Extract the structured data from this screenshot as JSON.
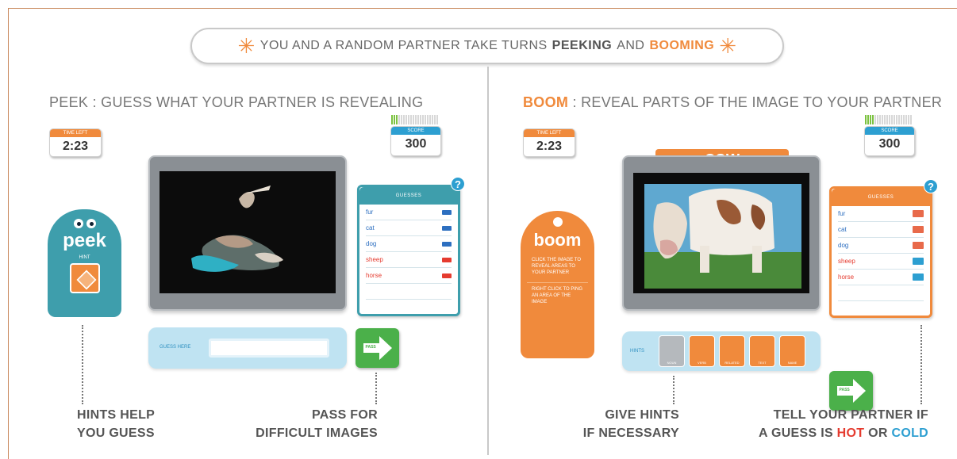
{
  "banner": {
    "text_pre": "YOU AND A RANDOM PARTNER TAKE TURNS",
    "peeking": "PEEKING",
    "and": "AND",
    "booming": "BOOMING"
  },
  "peek": {
    "title_hl": "PEEK",
    "title_rest": ": GUESS WHAT YOUR PARTNER IS REVEALING",
    "timer_caption": "TIME LEFT",
    "timer": "2:23",
    "score_caption": "SCORE",
    "score": "300",
    "character_label": "peek",
    "character_small": "HINT",
    "guesses_header": "GUESSES",
    "guesses": [
      {
        "word": "fur",
        "color": "#2d6fc0",
        "tag": "#2d6fc0"
      },
      {
        "word": "cat",
        "color": "#2d6fc0",
        "tag": "#2d6fc0"
      },
      {
        "word": "dog",
        "color": "#2d6fc0",
        "tag": "#2d6fc0"
      },
      {
        "word": "sheep",
        "color": "#e53b2f",
        "tag": "#e53b2f"
      },
      {
        "word": "horse",
        "color": "#e53b2f",
        "tag": "#e53b2f"
      }
    ],
    "guess_label": "GUESS HERE",
    "guess_value": "",
    "pass_label": "PASS",
    "caption_left": [
      "HINTS HELP",
      "YOU GUESS"
    ],
    "caption_right": [
      "PASS FOR",
      "DIFFICULT IMAGES"
    ]
  },
  "boom": {
    "title_hl": "BOOM",
    "title_rest": ": REVEAL PARTS OF THE IMAGE TO YOUR PARTNER",
    "timer_caption": "TIME LEFT",
    "timer": "2:23",
    "score_caption": "SCORE",
    "score": "300",
    "word": "COW",
    "character_label": "boom",
    "character_instr": "CLICK THE IMAGE TO REVEAL AREAS TO YOUR PARTNER",
    "character_instr2": "RIGHT CLICK TO PING AN AREA OF THE IMAGE",
    "guesses_header": "GUESSES",
    "guesses": [
      {
        "word": "fur",
        "color": "#2d6fc0",
        "tag": "#e86a4a"
      },
      {
        "word": "cat",
        "color": "#2d6fc0",
        "tag": "#e86a4a"
      },
      {
        "word": "dog",
        "color": "#2d6fc0",
        "tag": "#e86a4a"
      },
      {
        "word": "sheep",
        "color": "#e53b2f",
        "tag": "#2d9fd1"
      },
      {
        "word": "horse",
        "color": "#e53b2f",
        "tag": "#2d9fd1"
      }
    ],
    "hints_label": "HINTS",
    "hint_tiles": [
      "NOUN",
      "VERB",
      "RELATED",
      "TEXT",
      "NAME"
    ],
    "pass_label": "PASS",
    "caption_left": [
      "GIVE HINTS",
      "IF NECESSARY"
    ],
    "caption_right_1": "TELL YOUR PARTNER IF",
    "caption_right_2a": "A GUESS IS",
    "hot": "HOT",
    "or": "OR",
    "cold": "COLD"
  },
  "colors": {
    "orange": "#f08a3c",
    "blue": "#2d9fd1",
    "teal": "#3e9eac",
    "green": "#4bb04a",
    "hot": "#e53b2f",
    "cold": "#2d9fd1"
  }
}
